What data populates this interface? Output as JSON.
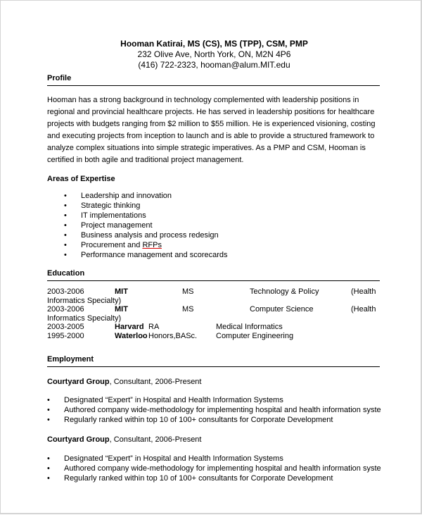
{
  "header": {
    "name": "Hooman Katirai, MS (CS), MS (TPP), CSM, PMP",
    "address": "232 Olive Ave,  North York, ON, M2N 4P6",
    "contact": "(416) 722-2323, hooman@alum.MIT.edu"
  },
  "profile": {
    "title": "Profile",
    "lines": [
      "Hooman has a strong background in technology complemented with leadership positions in",
      "regional and provincial healthcare projects. He has served in leadership positions for healthcare",
      "projects with budgets ranging from $2 million to $55 million.  He is experienced visioning, costing",
      "and executing projects from inception to launch and is able to provide a structured framework to",
      "analyze complex situations into simple strategic imperatives.  As a PMP and CSM, Hooman is",
      "certified in both agile and traditional project management."
    ]
  },
  "expertise": {
    "title": "Areas of Expertise",
    "bullet": "•",
    "items": [
      "Leadership and innovation",
      "Strategic thinking",
      "IT implementations",
      "Project management",
      "Business analysis and process redesign",
      "Procurement and ",
      "Performance management and scorecards"
    ],
    "misspelled_word": "RFPs"
  },
  "education": {
    "title": "Education",
    "rows": [
      {
        "years": "2003-2006",
        "school": "MIT",
        "degree": "MS",
        "field": "Technology & Policy",
        "note": "(Health",
        "continued": "Informatics Specialty)"
      },
      {
        "years": "2003-2006",
        "school": "MIT",
        "degree": "MS",
        "field": "Computer Science",
        "note": "(Health",
        "continued": "Informatics Specialty)"
      },
      {
        "years": "2003-2005",
        "school": "Harvard",
        "degree": "RA",
        "field": "Medical Informatics"
      },
      {
        "years": "1995-2000",
        "school": "Waterloo",
        "degree": "Honors,BASc.",
        "field": "Computer Engineering"
      }
    ]
  },
  "employment": {
    "title": "Employment",
    "bullet": "•",
    "jobs": [
      {
        "company": "Courtyard Group",
        "details": ", Consultant, 2006-Present",
        "duties": [
          "Designated “Expert” in Hospital and Health Information Systems",
          "Authored company wide-methodology for implementing hospital and health information systems",
          "Regularly ranked within top 10 of 100+ consultants for Corporate Development"
        ]
      },
      {
        "company": "Courtyard Group",
        "details": ", Consultant, 2006-Present",
        "duties": [
          "Designated “Expert” in Hospital and Health Information Systems",
          "Authored company wide-methodology for implementing hospital and health information systems",
          "Regularly ranked within top 10 of 100+ consultants for Corporate Development"
        ]
      }
    ]
  }
}
